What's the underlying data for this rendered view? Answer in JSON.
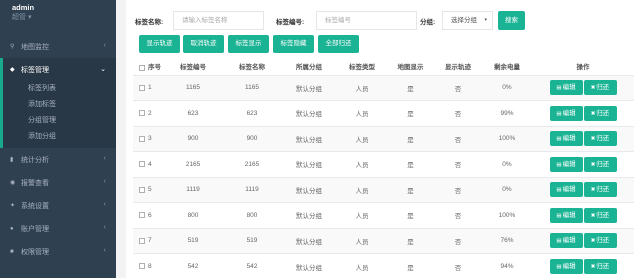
{
  "sidebar": {
    "user_name": "admin",
    "user_role": "超管",
    "caret": "▾",
    "chevron": "‹",
    "open_chevron": "⌄",
    "items": [
      {
        "icon": "⚲",
        "icon_name": "map-pin-icon",
        "label": "地图监控"
      },
      {
        "icon": "◆",
        "icon_name": "users-icon",
        "label": "标签管理"
      },
      {
        "icon": "▮",
        "icon_name": "bar-chart-icon",
        "label": "统计分析"
      },
      {
        "icon": "◉",
        "icon_name": "eye-icon",
        "label": "报警查看"
      },
      {
        "icon": "✦",
        "icon_name": "wrench-icon",
        "label": "系统设置"
      },
      {
        "icon": "●",
        "icon_name": "user-icon",
        "label": "账户管理"
      },
      {
        "icon": "■",
        "icon_name": "lock-icon",
        "label": "权限管理"
      }
    ],
    "sub_items": [
      "标签列表",
      "添加标签",
      "分组管理",
      "添加分组"
    ]
  },
  "filters": {
    "name_label": "标签名称:",
    "name_placeholder": "请输入标签名称",
    "number_label": "标签编号:",
    "number_placeholder": "标签编号",
    "group_label": "分组:",
    "group_selected": "选择分组",
    "group_caret": "▾",
    "search_label": "搜索"
  },
  "actions": [
    "显示轨迹",
    "取消轨迹",
    "标签显示",
    "标签隐藏",
    "全部归还"
  ],
  "table": {
    "columns": [
      "序号",
      "标签编号",
      "标签名称",
      "所属分组",
      "标签类型",
      "地图显示",
      "显示轨迹",
      "剩余电量",
      "操作"
    ],
    "edit_label": "编辑",
    "edit_icon": "▤",
    "return_label": "归还",
    "return_icon": "✖",
    "rows": [
      {
        "idx": "1",
        "number": "1165",
        "name": "1165",
        "group": "默认分组",
        "type": "人员",
        "map": "是",
        "track": "否",
        "battery": "0%"
      },
      {
        "idx": "2",
        "number": "623",
        "name": "623",
        "group": "默认分组",
        "type": "人员",
        "map": "是",
        "track": "否",
        "battery": "99%"
      },
      {
        "idx": "3",
        "number": "900",
        "name": "900",
        "group": "默认分组",
        "type": "人员",
        "map": "是",
        "track": "否",
        "battery": "100%"
      },
      {
        "idx": "4",
        "number": "2165",
        "name": "2165",
        "group": "默认分组",
        "type": "人员",
        "map": "是",
        "track": "否",
        "battery": "0%"
      },
      {
        "idx": "5",
        "number": "1119",
        "name": "1119",
        "group": "默认分组",
        "type": "人员",
        "map": "是",
        "track": "否",
        "battery": "0%"
      },
      {
        "idx": "6",
        "number": "800",
        "name": "800",
        "group": "默认分组",
        "type": "人员",
        "map": "是",
        "track": "否",
        "battery": "100%"
      },
      {
        "idx": "7",
        "number": "519",
        "name": "519",
        "group": "默认分组",
        "type": "人员",
        "map": "是",
        "track": "否",
        "battery": "76%"
      },
      {
        "idx": "8",
        "number": "542",
        "name": "542",
        "group": "默认分组",
        "type": "人员",
        "map": "是",
        "track": "否",
        "battery": "94%"
      }
    ]
  },
  "colors": {
    "sidebar_bg": "#2f4050",
    "accent": "#1ab394"
  }
}
